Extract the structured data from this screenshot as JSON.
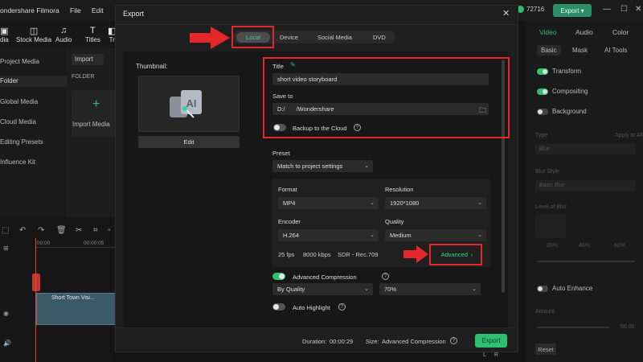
{
  "app": {
    "name": "ondershare Filmora",
    "menu": [
      "File",
      "Edit"
    ],
    "coins": "72716",
    "export_label": "Export"
  },
  "toolbar": {
    "items": [
      {
        "label": "dia",
        "icon": "media-icon"
      },
      {
        "label": "Stock Media",
        "icon": "stock-media-icon"
      },
      {
        "label": "Audio",
        "icon": "audio-icon"
      },
      {
        "label": "Titles",
        "icon": "titles-icon"
      },
      {
        "label": "Tr",
        "icon": "transitions-icon"
      }
    ]
  },
  "left_nav": {
    "items": [
      "Project Media",
      "Folder",
      "Global Media",
      "Cloud Media",
      "Editing Presets",
      "Influence Kit"
    ]
  },
  "media": {
    "import_dropdown": "Import",
    "folder_label": "FOLDER",
    "import_tile_label": "Import Media"
  },
  "timeline": {
    "ruler_marks": [
      "00:00",
      "00:00:05"
    ],
    "clip_title": "Short Town Visi..."
  },
  "right_panel": {
    "tabs": [
      "Video",
      "Audio",
      "Color"
    ],
    "subtabs": [
      "Basic",
      "Mask",
      "AI Tools"
    ],
    "rows": [
      "Transform",
      "Compositing",
      "Background",
      "Auto Enhance"
    ],
    "dim_labels": [
      "Type",
      "Blur Style",
      "Level of Blur",
      "Amount"
    ],
    "dim_fields": [
      "Blur",
      "Basic Blur",
      "Apply to All"
    ],
    "blur_levels": [
      "20%",
      "40%",
      "60%"
    ],
    "amount_value": "50.00",
    "reset_label": "Reset",
    "corner_letters": [
      "L",
      "R"
    ]
  },
  "export_dialog": {
    "title": "Export",
    "tabs": [
      "Local",
      "Device",
      "Social Media",
      "DVD"
    ],
    "active_tab": "Local",
    "thumbnail_label": "Thumbnail:",
    "thumbnail_art_text": "AI",
    "edit_label": "Edit",
    "title_label": "Title",
    "title_value": "short video storyboard",
    "save_to_label": "Save to",
    "save_drive": "D:/",
    "save_path": "/Wondershare",
    "backup_label": "Backup to the Cloud",
    "preset_label": "Preset",
    "preset_value": "Match to project settings",
    "format_label": "Format",
    "format_value": "MP4",
    "resolution_label": "Resolution",
    "resolution_value": "1920*1080",
    "encoder_label": "Encoder",
    "encoder_value": "H.264",
    "quality_label": "Quality",
    "quality_value": "Medium",
    "info": [
      "25 fps",
      "8000 kbps",
      "SDR - Rec.709"
    ],
    "advanced_label": "Advanced",
    "adv_compression_label": "Advanced Compression",
    "compression_mode": "By Quality",
    "compression_value": "70%",
    "auto_highlight_label": "Auto Highlight",
    "duration_label": "Duration:",
    "duration_value": "00:00:29",
    "size_label": "Size:",
    "size_value": "Advanced Compression",
    "export_label": "Export"
  },
  "colors": {
    "accent": "#2fbf71",
    "accent_text": "#2fd6a0",
    "annotation_red": "#e3272b"
  }
}
